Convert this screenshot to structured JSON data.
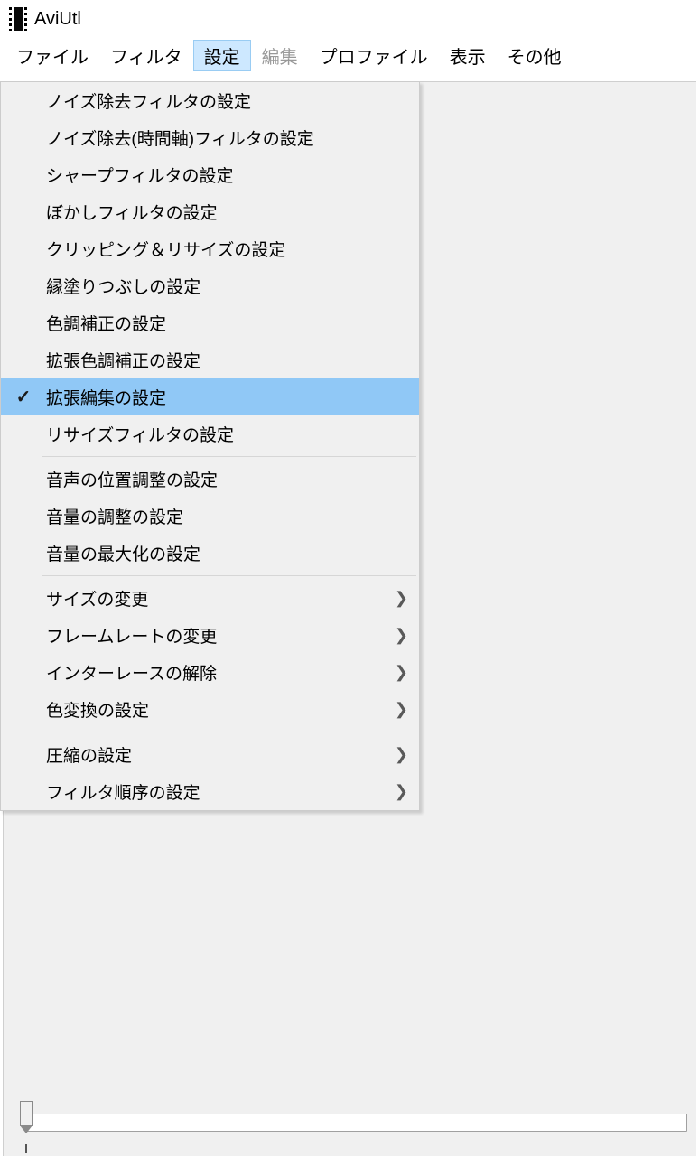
{
  "title": "AviUtl",
  "menubar": {
    "file": "ファイル",
    "filter": "フィルタ",
    "settings": "設定",
    "edit": "編集",
    "profile": "プロファイル",
    "view": "表示",
    "other": "その他"
  },
  "dropdown": {
    "group1": [
      "ノイズ除去フィルタの設定",
      "ノイズ除去(時間軸)フィルタの設定",
      "シャープフィルタの設定",
      "ぼかしフィルタの設定",
      "クリッピング＆リサイズの設定",
      "縁塗りつぶしの設定",
      "色調補正の設定",
      "拡張色調補正の設定",
      "拡張編集の設定",
      "リサイズフィルタの設定"
    ],
    "group2": [
      "音声の位置調整の設定",
      "音量の調整の設定",
      "音量の最大化の設定"
    ],
    "group3": [
      "サイズの変更",
      "フレームレートの変更",
      "インターレースの解除",
      "色変換の設定"
    ],
    "group4": [
      "圧縮の設定",
      "フィルタ順序の設定"
    ]
  }
}
